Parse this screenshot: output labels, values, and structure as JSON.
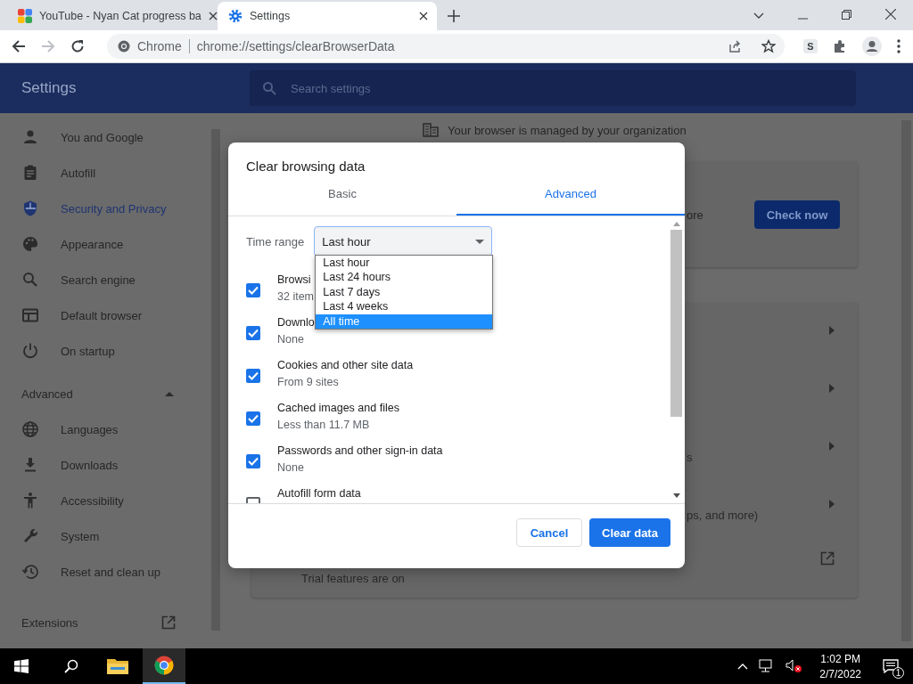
{
  "browser": {
    "tabs": [
      {
        "title": "YouTube - Nyan Cat progress ba",
        "selected": false
      },
      {
        "title": "Settings",
        "selected": true
      }
    ],
    "address": {
      "site_label": "Chrome",
      "url": "chrome://settings/clearBrowserData"
    },
    "extension_badge": "S"
  },
  "settings": {
    "title": "Settings",
    "search": {
      "placeholder": "Search settings"
    },
    "sidebar": {
      "items": [
        {
          "label": "You and Google",
          "selected": false
        },
        {
          "label": "Autofill",
          "selected": false
        },
        {
          "label": "Security and Privacy",
          "selected": true
        },
        {
          "label": "Appearance",
          "selected": false
        },
        {
          "label": "Search engine",
          "selected": false
        },
        {
          "label": "Default browser",
          "selected": false
        },
        {
          "label": "On startup",
          "selected": false
        }
      ],
      "advanced": {
        "label": "Advanced",
        "expanded": true,
        "items": [
          {
            "label": "Languages",
            "selected": false
          },
          {
            "label": "Downloads",
            "selected": false
          },
          {
            "label": "Accessibility",
            "selected": false
          },
          {
            "label": "System",
            "selected": false
          },
          {
            "label": "Reset and clean up",
            "selected": false
          }
        ]
      },
      "extensions": "Extensions"
    },
    "managed_notice": "Your browser is managed by your organization",
    "safety_card": {
      "text": "ore",
      "button": "Check now"
    },
    "rows": [
      {
        "kind": "submenu"
      },
      {
        "kind": "submenu"
      },
      {
        "kind": "submenu",
        "text": "s"
      },
      {
        "kind": "submenu",
        "text": "ps, and more)"
      },
      {
        "kind": "external",
        "text": "Trial features are on"
      }
    ]
  },
  "dialog": {
    "title": "Clear browsing data",
    "tabs": [
      {
        "label": "Basic",
        "selected": false
      },
      {
        "label": "Advanced",
        "selected": true
      }
    ],
    "time_range": {
      "label": "Time range",
      "value": "Last hour",
      "open": true,
      "options": [
        {
          "label": "Last hour",
          "highlighted": false
        },
        {
          "label": "Last 24 hours",
          "highlighted": false
        },
        {
          "label": "Last 7 days",
          "highlighted": false
        },
        {
          "label": "Last 4 weeks",
          "highlighted": false
        },
        {
          "label": "All time",
          "highlighted": true
        }
      ]
    },
    "items": [
      {
        "label": "Browsi",
        "detail": "32 item",
        "checked": true
      },
      {
        "label": "Downlo",
        "detail": "None",
        "checked": true
      },
      {
        "label": "Cookies and other site data",
        "detail": "From 9 sites",
        "checked": true
      },
      {
        "label": "Cached images and files",
        "detail": "Less than 11.7 MB",
        "checked": true
      },
      {
        "label": "Passwords and other sign-in data",
        "detail": "None",
        "checked": true
      },
      {
        "label": "Autofill form data",
        "checked": false
      }
    ],
    "buttons": {
      "cancel": "Cancel",
      "confirm": "Clear data"
    }
  },
  "taskbar": {
    "time": "1:02 PM",
    "date": "2/7/2022",
    "notifications": "1"
  }
}
